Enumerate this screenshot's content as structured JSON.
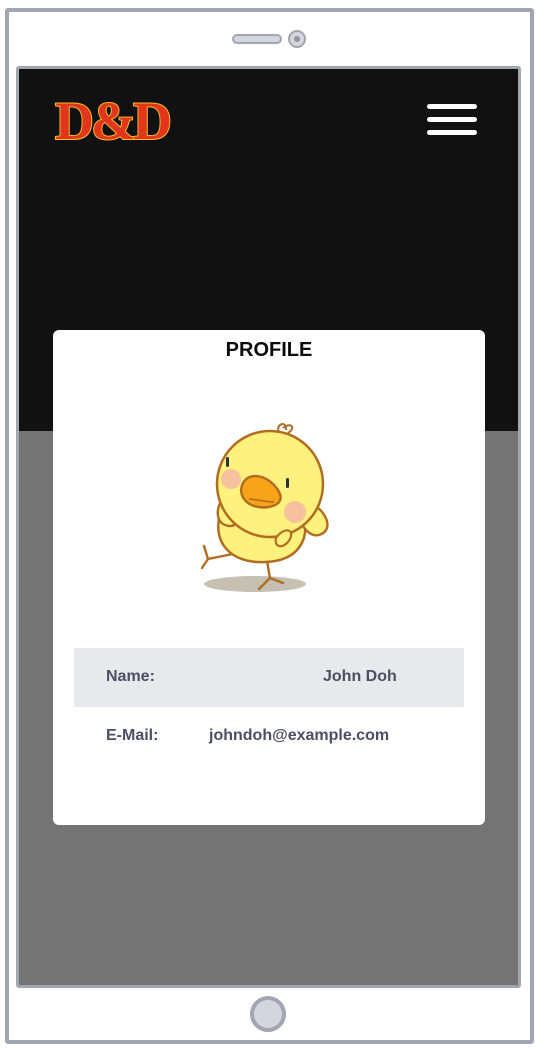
{
  "app": {
    "logo_text": "D&D",
    "colors": {
      "header": "#111111",
      "screen_background": "#747474",
      "card": "#ffffff",
      "logo_red": "#e2361c",
      "logo_glow": "#f7b92a"
    }
  },
  "header": {
    "logo_icon": "dnd-ampersand-logo",
    "menu_icon": "hamburger-menu-icon"
  },
  "profile": {
    "title": "PROFILE",
    "avatar_icon": "yellow-chick-avatar",
    "fields": {
      "name": {
        "label": "Name:",
        "value": "John Doh"
      },
      "email": {
        "label": "E-Mail:",
        "value": "johndoh@example.com"
      }
    }
  }
}
